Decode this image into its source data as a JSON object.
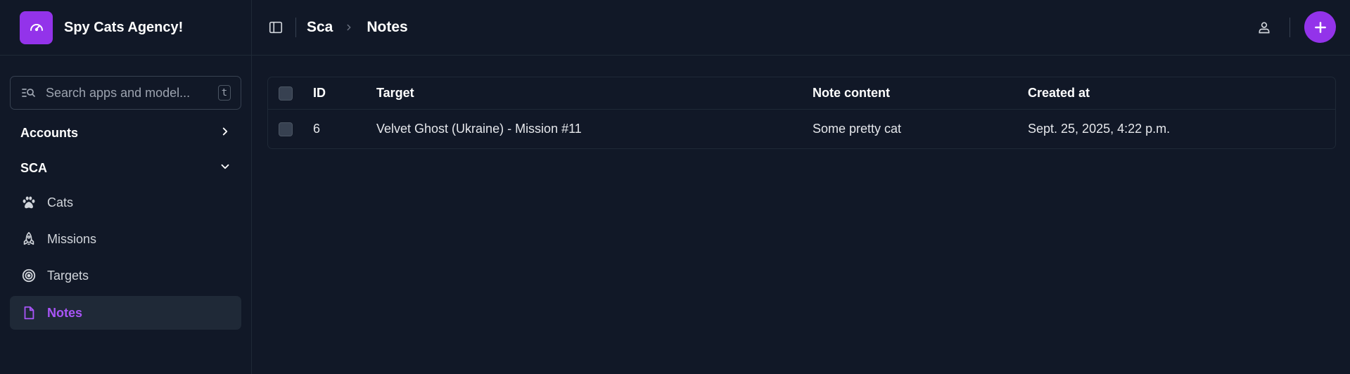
{
  "brand": {
    "name": "Spy Cats Agency!",
    "icon": "gauge-icon"
  },
  "search": {
    "placeholder": "Search apps and model...",
    "shortcut": "t"
  },
  "sidebar": {
    "groups": [
      {
        "label": "Accounts",
        "state": "collapsed"
      },
      {
        "label": "SCA",
        "state": "expanded"
      }
    ],
    "items": [
      {
        "label": "Cats",
        "icon": "paw-icon"
      },
      {
        "label": "Missions",
        "icon": "rocket-icon"
      },
      {
        "label": "Targets",
        "icon": "target-icon"
      },
      {
        "label": "Notes",
        "icon": "file-icon",
        "active": true
      }
    ]
  },
  "breadcrumb": {
    "parent": "Sca",
    "current": "Notes"
  },
  "table": {
    "columns": [
      "ID",
      "Target",
      "Note content",
      "Created at"
    ],
    "rows": [
      {
        "id": "6",
        "target": "Velvet Ghost (Ukraine) - Mission #11",
        "note": "Some pretty cat",
        "created": "Sept. 25, 2025, 4:22 p.m."
      }
    ]
  },
  "colors": {
    "accent": "#9333ea",
    "accent_text": "#a855f7",
    "background": "#111827"
  }
}
